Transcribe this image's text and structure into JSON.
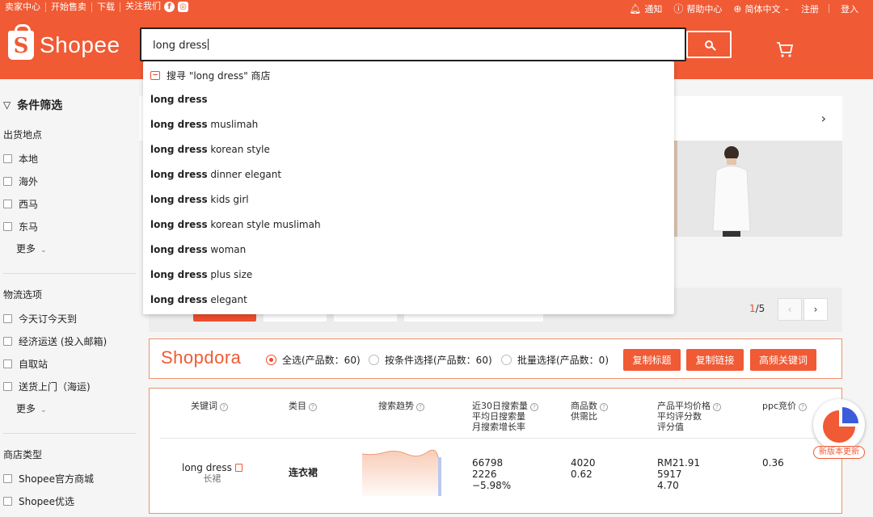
{
  "topbar": {
    "left": [
      "卖家中心",
      "开始售卖",
      "下载",
      "关注我们"
    ],
    "right": {
      "notify": "通知",
      "help": "帮助中心",
      "lang": "简体中文",
      "register": "注册",
      "login": "登入"
    }
  },
  "logo": {
    "brand": "Shopee"
  },
  "search": {
    "query": "long dress"
  },
  "dropdown": {
    "store_suggestion": "搜寻 \"long dress\" 商店",
    "suggestions": [
      {
        "bold": "long dress",
        "rest": ""
      },
      {
        "bold": "long dress",
        "rest": " muslimah"
      },
      {
        "bold": "long dress",
        "rest": " korean style"
      },
      {
        "bold": "long dress",
        "rest": " dinner elegant"
      },
      {
        "bold": "long dress",
        "rest": " kids girl"
      },
      {
        "bold": "long dress",
        "rest": " korean style muslimah"
      },
      {
        "bold": "long dress",
        "rest": " woman"
      },
      {
        "bold": "long dress",
        "rest": " plus size"
      },
      {
        "bold": "long dress",
        "rest": " elegant"
      }
    ]
  },
  "sidebar": {
    "title": "条件筛选",
    "ship_from": {
      "title": "出货地点",
      "options": [
        "本地",
        "海外",
        "西马",
        "东马"
      ],
      "more": "更多"
    },
    "logistics": {
      "title": "物流选项",
      "options": [
        "今天订今天到",
        "经济运送 (投入邮箱)",
        "自取站",
        "送货上门（海运)"
      ],
      "more": "更多"
    },
    "shop_type": {
      "title": "商店类型",
      "options": [
        "Shopee官方商城",
        "Shopee优选"
      ]
    }
  },
  "pager": {
    "current": "1",
    "total": "/5"
  },
  "shopdora": {
    "logo": "Shopdora",
    "radio_all": "全选(产品数：60)",
    "radio_cond": "按条件选择(产品数：60)",
    "radio_batch": "批量选择(产品数：0)",
    "btn_copy_title": "复制标题",
    "btn_copy_link": "复制链接",
    "btn_keywords": "高频关键词"
  },
  "keyword_table": {
    "headers": {
      "keyword": "关键词",
      "category": "类目",
      "trend": "搜索趋势",
      "search_1": "近30日搜索量",
      "search_2": "平均日搜索量",
      "search_3": "月搜索增长率",
      "products_1": "商品数",
      "products_2": "供需比",
      "price_1": "产品平均价格",
      "price_2": "平均评分数",
      "price_3": "评分值",
      "ppc": "ppc竞价"
    },
    "row": {
      "keyword": "long dress",
      "keyword_sub": "长裙",
      "category": "连衣裙",
      "search_30d": "66798",
      "search_daily": "2226",
      "search_growth": "−5.98%",
      "product_count": "4020",
      "supply_ratio": "0.62",
      "avg_price": "RM21.91",
      "avg_reviews": "5917",
      "rating": "4.70",
      "ppc": "0.36"
    }
  },
  "update_badge": {
    "label": "新版本更新"
  },
  "colors": {
    "brand": "#f05a34",
    "accent": "#ee4d2d"
  }
}
